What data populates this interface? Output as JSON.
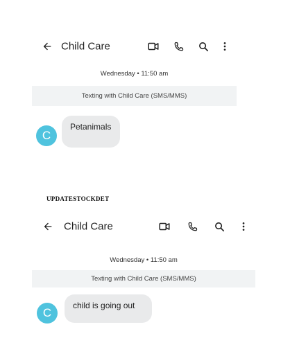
{
  "screenshots": [
    {
      "header": {
        "back_icon": "arrow-left-icon",
        "title": "Child Care",
        "actions": [
          "video-call-icon",
          "phone-icon",
          "search-icon",
          "more-vertical-icon"
        ]
      },
      "date_separator": "Wednesday • 11:50 am",
      "banner": "Texting with Child Care (SMS/MMS)",
      "avatar_letter": "C",
      "message": "Petanimals"
    },
    {
      "header": {
        "back_icon": "arrow-left-icon",
        "title": "Child Care",
        "actions": [
          "video-call-icon",
          "phone-icon",
          "search-icon",
          "more-vertical-icon"
        ]
      },
      "date_separator": "Wednesday • 11:50 am",
      "banner": "Texting with Child Care (SMS/MMS)",
      "avatar_letter": "C",
      "message": "child is going out"
    }
  ],
  "watermark": "UPDATESTOCKDET",
  "colors": {
    "avatar": "#4fc3de",
    "bubble": "#e9eaeb",
    "banner": "#f1f3f4",
    "text": "#1f1f1f"
  }
}
